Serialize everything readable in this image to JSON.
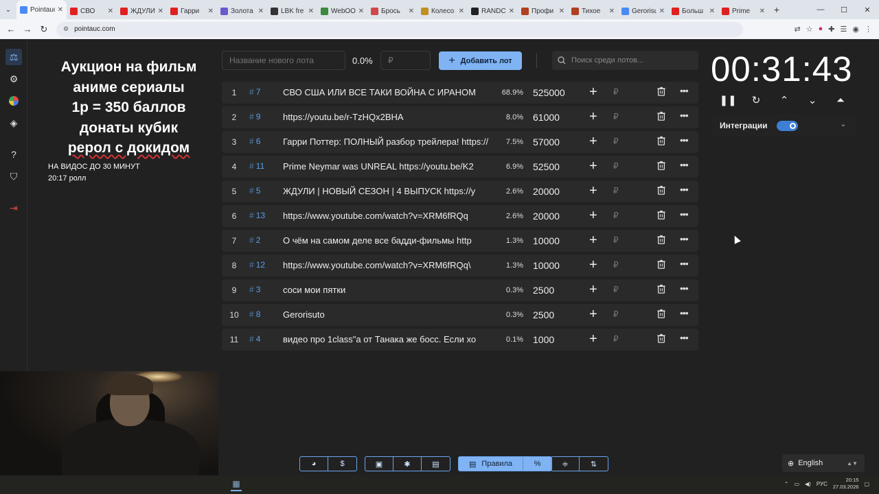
{
  "browser": {
    "tabs": [
      {
        "label": "Pointauc",
        "color": "#4a8af4",
        "active": true
      },
      {
        "label": "СВО",
        "color": "#e02020"
      },
      {
        "label": "ЖДУЛИ",
        "color": "#e02020"
      },
      {
        "label": "Гарри",
        "color": "#e02020"
      },
      {
        "label": "Золота",
        "color": "#6a5acd"
      },
      {
        "label": "LBK fre",
        "color": "#333333"
      },
      {
        "label": "WebOO",
        "color": "#3c8a3c"
      },
      {
        "label": "Брось",
        "color": "#d04848"
      },
      {
        "label": "Колесо",
        "color": "#c09020"
      },
      {
        "label": "RANDC",
        "color": "#222222"
      },
      {
        "label": "Профи",
        "color": "#b04020"
      },
      {
        "label": "Тихое",
        "color": "#b04020"
      },
      {
        "label": "Gerorisuto",
        "color": "#4a8af4"
      },
      {
        "label": "Больш",
        "color": "#e02020"
      },
      {
        "label": "Prime",
        "color": "#e02020"
      }
    ],
    "new_tab": "+",
    "url": "pointauc.com"
  },
  "page": {
    "title_lines": [
      "Аукцион на фильм",
      "аниме сериалы",
      "1р = 350 баллов",
      "донаты кубик",
      "рерол с докидом"
    ],
    "subtitle1": "НА ВИДОС ДО 30 МИНУТ",
    "subtitle2": "20:17 ролл"
  },
  "toolbar": {
    "lot_name_placeholder": "Название нового лота",
    "percent": "0.0%",
    "amount_placeholder": "₽",
    "add_label": "Добавить лот",
    "search_placeholder": "Поиск среди лотов..."
  },
  "lots": [
    {
      "n": "1",
      "id": "7",
      "name": "СВО США ИЛИ ВСЕ ТАКИ ВОЙНА С ИРАНОМ",
      "pct": "68.9%",
      "amount": "525000"
    },
    {
      "n": "2",
      "id": "9",
      "name": "https://youtu.be/r-TzHQx2BHA",
      "pct": "8.0%",
      "amount": "61000"
    },
    {
      "n": "3",
      "id": "6",
      "name": "Гарри Поттер: ПОЛНЫЙ разбор трейлера! https://",
      "pct": "7.5%",
      "amount": "57000"
    },
    {
      "n": "4",
      "id": "11",
      "name": "Prime Neymar was UNREAL https://youtu.be/K2",
      "pct": "6.9%",
      "amount": "52500"
    },
    {
      "n": "5",
      "id": "5",
      "name": "ЖДУЛИ | НОВЫЙ СЕЗОН | 4 ВЫПУСК https://y",
      "pct": "2.6%",
      "amount": "20000"
    },
    {
      "n": "6",
      "id": "13",
      "name": "https://www.youtube.com/watch?v=XRM6fRQq",
      "pct": "2.6%",
      "amount": "20000"
    },
    {
      "n": "7",
      "id": "2",
      "name": " О чём на самом деле все бадди-фильмы http",
      "pct": "1.3%",
      "amount": "10000"
    },
    {
      "n": "8",
      "id": "12",
      "name": "https://www.youtube.com/watch?v=XRM6fRQq\\",
      "pct": "1.3%",
      "amount": "10000"
    },
    {
      "n": "9",
      "id": "3",
      "name": "соси мои пятки",
      "pct": "0.3%",
      "amount": "2500"
    },
    {
      "n": "10",
      "id": "8",
      "name": "Gerorisuto",
      "pct": "0.3%",
      "amount": "2500"
    },
    {
      "n": "11",
      "id": "4",
      "name": "видео про 1class\"а от Танака же босс. Если хо",
      "pct": "0.1%",
      "amount": "1000"
    }
  ],
  "lot_plus": "+",
  "lot_currency": "₽",
  "lot_hash": "#",
  "timer": {
    "value": "00:31:43"
  },
  "integrations": {
    "label": "Интеграции",
    "enabled": true
  },
  "bottom": {
    "rules_label": "Правила"
  },
  "language": {
    "label": "English"
  },
  "taskbar": {
    "lang": "РУС",
    "time": "20:15",
    "date": "27.03.2026"
  }
}
